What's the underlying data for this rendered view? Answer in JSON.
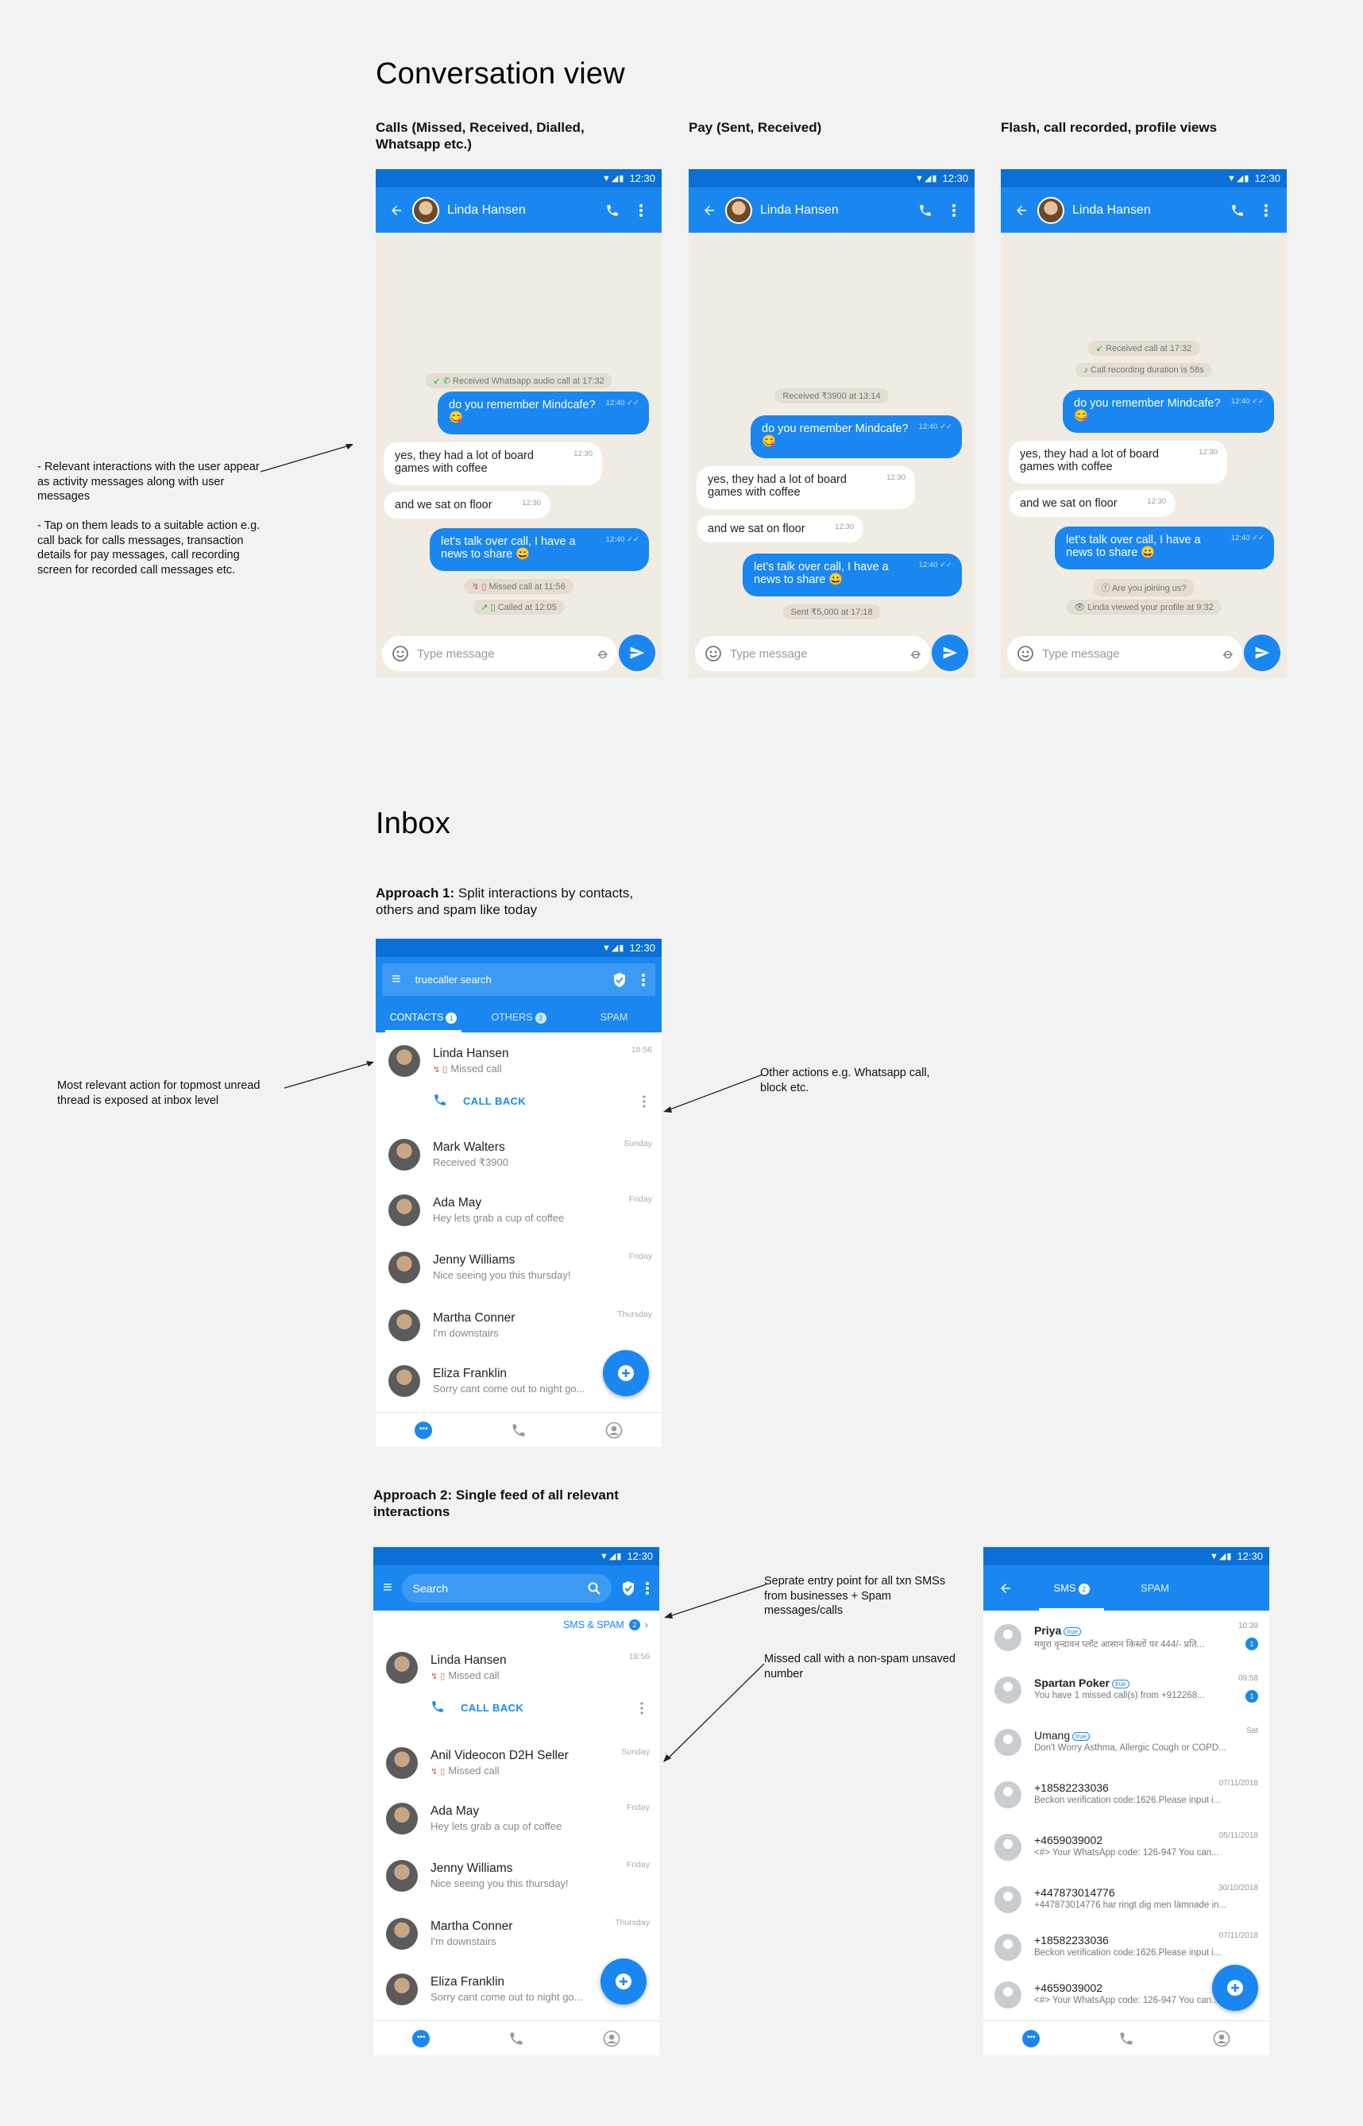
{
  "section1": {
    "title": "Conversation view",
    "captions": [
      "Calls (Missed, Received, Dialled, Whatsapp etc.)",
      "Pay (Sent, Received)",
      "Flash, call recorded, profile views"
    ],
    "note": "- Relevant interactions with the user appear as activity messages along with user messages\n\n- Tap on them leads to a suitable action e.g. call back for calls messages, transaction details for pay messages, call recording screen for recorded call messages etc."
  },
  "status_time": "12:30",
  "chat": {
    "contact": "Linda Hansen",
    "input_placeholder": "Type message",
    "msg_out1": "do you remember Mindcafe?😋",
    "msg_in1": "yes, they had a lot of board games with coffee",
    "msg_in2": "and we sat on floor",
    "msg_out2": "let's talk over call, I have a news to share 😀",
    "t_out": "12:40 ✓✓",
    "t_in": "12:30",
    "phone1": {
      "top_pill": "Received Whatsapp audio call at 17:32",
      "pill_a": "Missed call at 11:56",
      "pill_b": "Called at 12:05"
    },
    "phone2": {
      "top_pill": "Received ₹3900 at 13:14",
      "bottom_pill": "Sent ₹5,000 at 17:18"
    },
    "phone3": {
      "pill_a": "Received call at 17:32",
      "pill_b": "Call recording duration is 58s",
      "pill_c": "Are you joining us?",
      "pill_d": "Linda viewed your profile at 9:32"
    }
  },
  "section2": {
    "title": "Inbox",
    "approach1_bold": "Approach 1:",
    "approach1_rest": " Split interactions by contacts, others and spam like today",
    "approach2": "Approach 2: Single feed of all relevant interactions",
    "note_left": "Most relevant action for topmost unread thread is exposed at inbox level",
    "note_right": "Other actions e.g. Whatsapp call, block etc.",
    "note_sms": "Seprate entry point for all txn SMSs from businesses + Spam messages/calls",
    "note_missed": "Missed call with a non-spam unsaved number"
  },
  "inbox1": {
    "search": "truecaller search",
    "tabs": [
      "CONTACTS",
      "OTHERS",
      "SPAM"
    ],
    "tab_counts": [
      "1",
      "3"
    ],
    "call_back": "CALL BACK"
  },
  "inbox2": {
    "search": "Search",
    "sms_link": "SMS & SPAM",
    "sms_count": "2",
    "call_back": "CALL BACK"
  },
  "threads1": [
    {
      "name": "Linda Hansen",
      "sub": "Missed call",
      "date": "18:56"
    },
    {
      "name": "Mark Walters",
      "sub": "Received ₹3900",
      "date": "Sunday"
    },
    {
      "name": "Ada May",
      "sub": "Hey lets grab a cup of coffee",
      "date": "Friday"
    },
    {
      "name": "Jenny Williams",
      "sub": "Nice seeing you this thursday!",
      "date": "Friday"
    },
    {
      "name": "Martha Conner",
      "sub": "I'm downstairs",
      "date": "Thursday"
    },
    {
      "name": "Eliza Franklin",
      "sub": "Sorry cant come out to night go...",
      "date": ""
    }
  ],
  "threads2": [
    {
      "name": "Linda Hansen",
      "sub": "Missed call",
      "date": "18:56"
    },
    {
      "name": "Anil Videocon D2H Seller",
      "sub": "Missed call",
      "date": "Sunday"
    },
    {
      "name": "Ada May",
      "sub": "Hey lets grab a cup of coffee",
      "date": "Friday"
    },
    {
      "name": "Jenny Williams",
      "sub": "Nice seeing you this thursday!",
      "date": "Friday"
    },
    {
      "name": "Martha Conner",
      "sub": "I'm downstairs",
      "date": "Thursday"
    },
    {
      "name": "Eliza Franklin",
      "sub": "Sorry cant come out to night go...",
      "date": ""
    }
  ],
  "sms": {
    "tabs": [
      "SMS",
      "SPAM"
    ],
    "tab_count": "2",
    "items": [
      {
        "name": "Priya",
        "sub": "मथुरा वृन्दावन प्लॉट आसान किस्तों पर 444/- प्रति...",
        "date": "10:39",
        "unread": "1"
      },
      {
        "name": "Spartan Poker",
        "sub": "You have 1 missed call(s) from +912268...",
        "date": "09:58",
        "unread": "1"
      },
      {
        "name": "Umang",
        "sub": "Don't Worry Asthma, Allergic Cough or COPD...",
        "date": "Sat",
        "unread": ""
      },
      {
        "name": "+18582233036",
        "sub": "Beckon verification code:1626.Please input i...",
        "date": "07/11/2018",
        "unread": ""
      },
      {
        "name": "+4659039002",
        "sub": "<#> Your WhatsApp code: 126-947  You can...",
        "date": "05/11/2018",
        "unread": ""
      },
      {
        "name": "+447873014776",
        "sub": "+447873014776 har ringt dig men lämnade in...",
        "date": "30/10/2018",
        "unread": ""
      },
      {
        "name": "+18582233036",
        "sub": "Beckon verification code:1626.Please input i...",
        "date": "07/11/2018",
        "unread": ""
      },
      {
        "name": "+4659039002",
        "sub": "<#> Your WhatsApp code: 126-947  You can...",
        "date": "",
        "unread": ""
      }
    ]
  }
}
